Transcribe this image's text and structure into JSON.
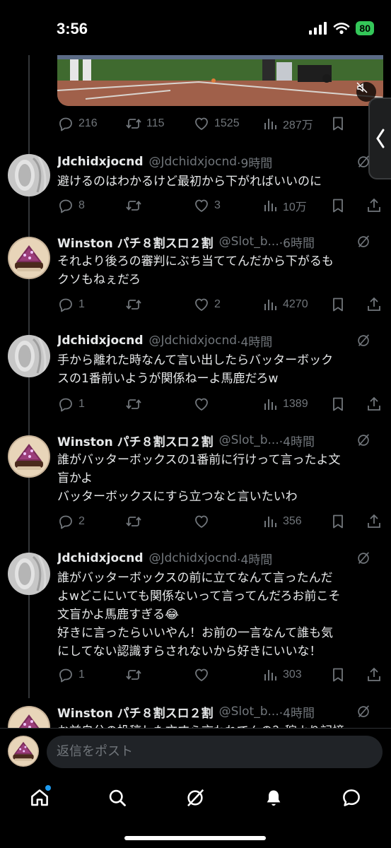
{
  "status": {
    "time": "3:56",
    "battery": "80"
  },
  "main_post": {
    "actions": {
      "replies": "216",
      "reposts": "115",
      "likes": "1525",
      "views": "287万"
    }
  },
  "posts": [
    {
      "name": "Jdchidxjocnd",
      "handle": "@Jdchidxjocnd",
      "time": "·9時間",
      "text": "避けるのはわかるけど最初から下がればいいのに",
      "replies": "8",
      "reposts": "",
      "likes": "3",
      "views": "10万"
    },
    {
      "name": "Winston パチ８割スロ２割",
      "handle": "@Slot_b...",
      "time": "·6時間",
      "text": "それより後ろの審判にぶち当ててんだから下がるも\nクソもねぇだろ",
      "replies": "1",
      "reposts": "",
      "likes": "2",
      "views": "4270"
    },
    {
      "name": "Jdchidxjocnd",
      "handle": "@Jdchidxjocnd",
      "time": "·4時間",
      "text": "手から離れた時なんて言い出したらバッターボック\nスの1番前いようが関係ねーよ馬鹿だろw",
      "replies": "1",
      "reposts": "",
      "likes": "",
      "views": "1389"
    },
    {
      "name": "Winston パチ８割スロ２割",
      "handle": "@Slot_b...",
      "time": "·4時間",
      "text": "誰がバッターボックスの1番前に行けって言ったよ文\n盲かよ\nバッターボックスにすら立つなと言いたいわ",
      "replies": "2",
      "reposts": "",
      "likes": "",
      "views": "356"
    },
    {
      "name": "Jdchidxjocnd",
      "handle": "@Jdchidxjocnd",
      "time": "·4時間",
      "text": "誰がバッターボックスの前に立てなんて言ったんだ\nよwどこにいても関係ないって言ってんだろお前こそ\n文盲かよ馬鹿すぎる😂\n好きに言ったらいいやん！お前の一言なんて誰も気\nにしてない認識すらされないから好きにいいな！",
      "replies": "1",
      "reposts": "",
      "likes": "",
      "views": "303"
    },
    {
      "name": "Winston パチ８割スロ２割",
      "handle": "@Slot_b...",
      "time": "·4時間",
      "text": "お前自分の投稿した文すら言われてんの？稼より記憶",
      "replies": "",
      "reposts": "",
      "likes": "",
      "views": ""
    }
  ],
  "reply_bar": {
    "placeholder": "返信をポスト"
  },
  "tab_bar": {
    "items": [
      "home-icon",
      "search-icon",
      "grok-icon",
      "notifications-icon",
      "messages-icon"
    ]
  },
  "colors": {
    "background": "#000000",
    "text": "#e7e9ea",
    "muted": "#71767b",
    "accent": "#1d9bf0",
    "battery": "#34c759"
  }
}
